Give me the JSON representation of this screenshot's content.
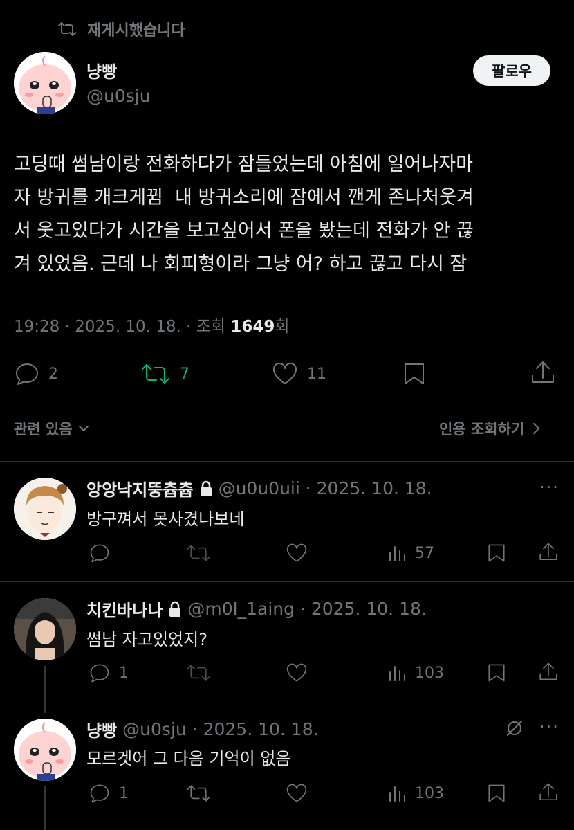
{
  "repost_label": "재게시했습니다",
  "author": {
    "name": "냥빵",
    "handle": "@u0sju"
  },
  "follow_label": "팔로우",
  "tweet_text": "고딩때 썸남이랑 전화하다가 잠들었는데 아침에 일어나자마\n자 방귀를 개크게뀜  내 방귀소리에 잠에서 깬게 존나처웃겨\n서 웃고있다가 시간을 보고싶어서 폰을 봤는데 전화가 안 끊\n겨 있었음. 근데 나 회피형이라 그냥 어? 하고 끊고 다시 잠",
  "meta": {
    "time": "19:28 · 2025. 10. 18. · 조회 ",
    "views": "1649",
    "views_suffix": "회"
  },
  "stats": {
    "replies": "2",
    "reposts": "7",
    "likes": "11"
  },
  "related_label": "관련 있음",
  "quotes_label": "인용 조회하기",
  "replies": [
    {
      "name": "앙앙낙지뚱츕츕",
      "handle": "@u0u0uii · 2025. 10. 18.",
      "text": "방구껴서 못사겼나보네",
      "reply_count": "",
      "views": "57"
    },
    {
      "name": "치킨바나나",
      "handle": "@m0l_1aing · 2025. 10. 18.",
      "text": "썸남 자고있었지?",
      "reply_count": "1",
      "views": "103"
    },
    {
      "name": "냥빵",
      "handle": "@u0sju · 2025. 10. 18.",
      "text": "모르겟어 그 다음 기억이 없음",
      "reply_count": "1",
      "views": "103"
    }
  ],
  "colors": {
    "background": "#000000",
    "text": "#e7e9ea",
    "muted": "#71767b",
    "repost_green": "#00ba7c",
    "divider": "#2f3336"
  }
}
